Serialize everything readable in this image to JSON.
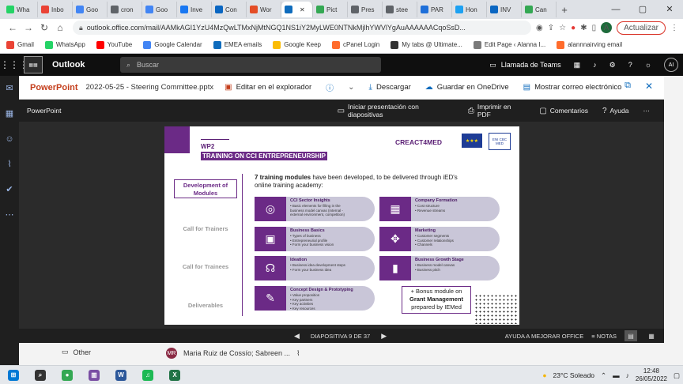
{
  "browser": {
    "tabs": [
      {
        "label": "Wha",
        "color": "#25d366"
      },
      {
        "label": "Inbo",
        "color": "#ea4335"
      },
      {
        "label": "Goo",
        "color": "#4285f4"
      },
      {
        "label": "cron",
        "color": "#5f6368"
      },
      {
        "label": "Goo",
        "color": "#4285f4"
      },
      {
        "label": "Inve",
        "color": "#1877f2"
      },
      {
        "label": "Con",
        "color": "#0a66c2"
      },
      {
        "label": "Wor",
        "color": "#e44d26"
      },
      {
        "label": "",
        "color": "#0f6cbd"
      },
      {
        "label": "Pict",
        "color": "#34a853"
      },
      {
        "label": "Pres",
        "color": "#5f6368"
      },
      {
        "label": "stee",
        "color": "#5f6368"
      },
      {
        "label": "PAR",
        "color": "#1e6fd9"
      },
      {
        "label": "Hon",
        "color": "#1da1f2"
      },
      {
        "label": "INV",
        "color": "#0a66c2"
      },
      {
        "label": "Can",
        "color": "#34a853"
      }
    ],
    "new_tab": "+",
    "url": "outlook.office.com/mail/AAMkAGI1YzU4MzQwLTMxNjMtNGQ1NS1iY2MyLWE0NTNkMjlhYWVlYgAuAAAAAACqoSsD...",
    "update_label": "Actualizar",
    "profile_initial": "A",
    "bookmarks": [
      {
        "label": "Gmail",
        "color": "#ea4335"
      },
      {
        "label": "WhatsApp",
        "color": "#25d366"
      },
      {
        "label": "YouTube",
        "color": "#ff0000"
      },
      {
        "label": "Google Calendar",
        "color": "#4285f4"
      },
      {
        "label": "EMEA emails",
        "color": "#0f6cbd"
      },
      {
        "label": "Google Keep",
        "color": "#fbbc04"
      },
      {
        "label": "cPanel Login",
        "color": "#ff6c2c"
      },
      {
        "label": "My tabs @ Ultimate...",
        "color": "#333333"
      },
      {
        "label": "Edit Page ‹ Alanna I...",
        "color": "#7a7a7a"
      },
      {
        "label": "alannnairving email",
        "color": "#ff6c2c"
      }
    ]
  },
  "outlook": {
    "brand": "Outlook",
    "search_placeholder": "Buscar",
    "teams_label": "Llamada de Teams",
    "avatar": "AI"
  },
  "viewer": {
    "app": "PowerPoint",
    "file": "2022-05-25 - Steering Committee.pptx",
    "edit_label": "Editar en el explorador",
    "download_label": "Descargar",
    "save_label": "Guardar en OneDrive",
    "show_mail_label": "Mostrar correo electrónico",
    "pp_name": "PowerPoint",
    "present_label": "Iniciar presentación con diapositivas",
    "print_label": "Imprimir en PDF",
    "comments_label": "Comentarios",
    "help_label": "Ayuda",
    "slide_counter": "DIAPOSITIVA 9 DE 37",
    "improve_label": "AYUDA A MEJORAR OFFICE",
    "notes_label": "NOTAS"
  },
  "slide": {
    "wp": "WP2",
    "title": "TRAINING ON CCI ENTREPRENEURSHIP",
    "logo": "CREACT4MED",
    "eu_flag": "★★★",
    "enpi_logo": "ENI CBC MED",
    "dev_box": "Development of Modules",
    "call_trainers": "Call for Trainers",
    "call_trainees": "Call for Trainees",
    "deliverables": "Deliverables",
    "intro_bold": "7 training modules",
    "intro_rest": " have been developed, to be delivered through iED's online training academy:",
    "modules": [
      {
        "title": "CCI Sector Insights",
        "icon": "◎",
        "lines": [
          "• Basic elements for filling in the",
          "business model canvas (internal -",
          "external environment, competition)"
        ]
      },
      {
        "title": "Company Formation",
        "icon": "▦",
        "lines": [
          "• Cost structure",
          "• Revenue streams"
        ]
      },
      {
        "title": "Business Basics",
        "icon": "▣",
        "lines": [
          "• Types of business",
          "• Entrepreneurial profile",
          "• Form your business vision"
        ]
      },
      {
        "title": "Marketing",
        "icon": "✥",
        "lines": [
          "• Customer segments",
          "• Customer relationships",
          "• Channels"
        ]
      },
      {
        "title": "Ideation",
        "icon": "☊",
        "lines": [
          "• Business idea development steps",
          "• Form your business idea"
        ]
      },
      {
        "title": "Business Growth Stage",
        "icon": "▮",
        "lines": [
          "• Business model canvas",
          "• Business pitch"
        ]
      },
      {
        "title": "Concept Design & Prototyping",
        "icon": "✎",
        "lines": [
          "• Value proposition",
          "• Key partners",
          "• Key activities",
          "• Key resources"
        ]
      }
    ],
    "bonus_line1": "+ Bonus module on",
    "bonus_line2": "Grant Management",
    "bonus_line3": "prepared by IEMed"
  },
  "below": {
    "folder": "Other",
    "mail_from": "Maria Ruiz de Cossío; Sabreen ...",
    "mail_initials": "MR"
  },
  "taskbar": {
    "apps": [
      {
        "glyph": "⊞",
        "color": "#0078d4"
      },
      {
        "glyph": "⌕",
        "color": "#333333"
      },
      {
        "glyph": "●",
        "color": "#34a853"
      },
      {
        "glyph": "▥",
        "color": "#7a4ea3"
      },
      {
        "glyph": "W",
        "color": "#2b579a"
      },
      {
        "glyph": "♫",
        "color": "#1db954"
      },
      {
        "glyph": "X",
        "color": "#217346"
      }
    ],
    "weather": "23°C  Soleado",
    "time": "12:48",
    "date": "26/05/2022"
  }
}
